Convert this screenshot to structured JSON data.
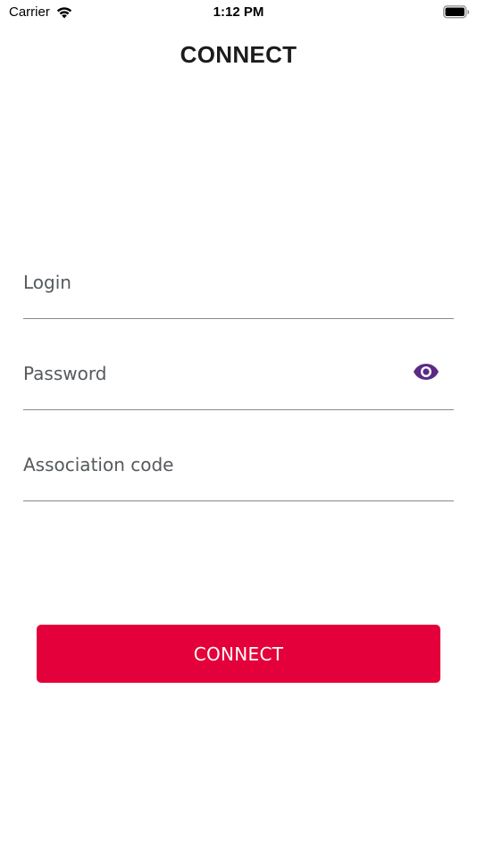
{
  "status_bar": {
    "carrier": "Carrier",
    "time": "1:12 PM",
    "wifi_icon": "wifi-icon",
    "battery_icon": "battery-icon"
  },
  "header": {
    "title": "CONNECT"
  },
  "form": {
    "login_placeholder": "Login",
    "login_value": "",
    "password_placeholder": "Password",
    "password_value": "",
    "password_toggle_icon": "eye-icon",
    "association_placeholder": "Association code",
    "association_value": ""
  },
  "actions": {
    "connect_label": "CONNECT"
  },
  "colors": {
    "accent": "#e4003a",
    "eye_icon": "#5b2a86",
    "underline": "#8a8a8a"
  }
}
